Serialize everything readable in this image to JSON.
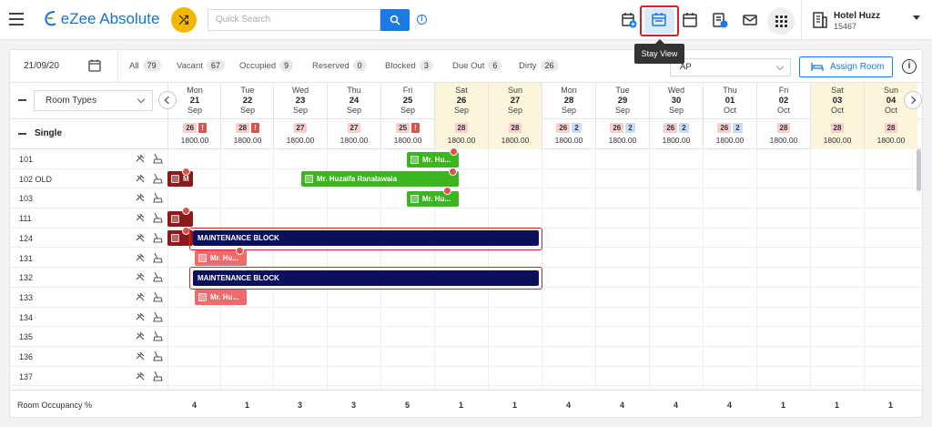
{
  "app": {
    "name": "eZee Absolute"
  },
  "search": {
    "placeholder": "Quick Search"
  },
  "tooltip": "Stay View",
  "hotel": {
    "name": "Hotel Huzz",
    "id": "15467"
  },
  "filters": {
    "date": "21/09/20",
    "items": [
      {
        "label": "All",
        "count": "79"
      },
      {
        "label": "Vacant",
        "count": "67"
      },
      {
        "label": "Occupied",
        "count": "9"
      },
      {
        "label": "Reserved",
        "count": "0"
      },
      {
        "label": "Blocked",
        "count": "3"
      },
      {
        "label": "Due Out",
        "count": "6"
      },
      {
        "label": "Dirty",
        "count": "26"
      }
    ],
    "rate_select": "AP",
    "assign_label": "Assign Room"
  },
  "grid": {
    "room_types_label": "Room Types",
    "category": "Single",
    "days": [
      {
        "dow": "Mon",
        "day": "21",
        "mon": "Sep",
        "weekend": false
      },
      {
        "dow": "Tue",
        "day": "22",
        "mon": "Sep",
        "weekend": false
      },
      {
        "dow": "Wed",
        "day": "23",
        "mon": "Sep",
        "weekend": false
      },
      {
        "dow": "Thu",
        "day": "24",
        "mon": "Sep",
        "weekend": false
      },
      {
        "dow": "Fri",
        "day": "25",
        "mon": "Sep",
        "weekend": false
      },
      {
        "dow": "Sat",
        "day": "26",
        "mon": "Sep",
        "weekend": true
      },
      {
        "dow": "Sun",
        "day": "27",
        "mon": "Sep",
        "weekend": true
      },
      {
        "dow": "Mon",
        "day": "28",
        "mon": "Sep",
        "weekend": false
      },
      {
        "dow": "Tue",
        "day": "29",
        "mon": "Sep",
        "weekend": false
      },
      {
        "dow": "Wed",
        "day": "30",
        "mon": "Sep",
        "weekend": false
      },
      {
        "dow": "Thu",
        "day": "01",
        "mon": "Oct",
        "weekend": false
      },
      {
        "dow": "Fri",
        "day": "02",
        "mon": "Oct",
        "weekend": false
      },
      {
        "dow": "Sat",
        "day": "03",
        "mon": "Oct",
        "weekend": true
      },
      {
        "dow": "Sun",
        "day": "04",
        "mon": "Oct",
        "weekend": true
      }
    ],
    "availability": [
      {
        "avail": "26",
        "flag": "!",
        "blue": "",
        "rate": "1800.00"
      },
      {
        "avail": "28",
        "flag": "!",
        "blue": "",
        "rate": "1800.00"
      },
      {
        "avail": "27",
        "flag": "",
        "blue": "",
        "rate": "1800.00"
      },
      {
        "avail": "27",
        "flag": "",
        "blue": "",
        "rate": "1800.00"
      },
      {
        "avail": "25",
        "flag": "!",
        "blue": "",
        "rate": "1800.00"
      },
      {
        "avail": "28",
        "flag": "",
        "blue": "",
        "rate": "1800.00"
      },
      {
        "avail": "28",
        "flag": "",
        "blue": "",
        "rate": "1800.00"
      },
      {
        "avail": "26",
        "flag": "",
        "blue": "2",
        "rate": "1800.00"
      },
      {
        "avail": "26",
        "flag": "",
        "blue": "2",
        "rate": "1800.00"
      },
      {
        "avail": "26",
        "flag": "",
        "blue": "2",
        "rate": "1800.00"
      },
      {
        "avail": "26",
        "flag": "",
        "blue": "2",
        "rate": "1800.00"
      },
      {
        "avail": "28",
        "flag": "",
        "blue": "",
        "rate": "1800.00"
      },
      {
        "avail": "28",
        "flag": "",
        "blue": "",
        "rate": "1800.00"
      },
      {
        "avail": "28",
        "flag": "",
        "blue": "",
        "rate": "1800.00"
      }
    ],
    "rooms": [
      "101",
      "102 OLD",
      "103",
      "111",
      "124",
      "131",
      "132",
      "133",
      "134",
      "135",
      "136",
      "137"
    ],
    "bookings": [
      {
        "text": "Mr. Hu...",
        "kind": "green"
      },
      {
        "text": "M",
        "kind": "maroon"
      },
      {
        "text": "Mr. Huzaifa Ranalawala",
        "kind": "green"
      },
      {
        "text": "Mr. Hu...",
        "kind": "green"
      },
      {
        "text": "",
        "kind": "maroon"
      },
      {
        "text": "",
        "kind": "maroon"
      },
      {
        "text": "MAINTENANCE BLOCK",
        "kind": "navy"
      },
      {
        "text": "Mr. Hu...",
        "kind": "pink"
      },
      {
        "text": "MAINTENANCE BLOCK",
        "kind": "navy"
      },
      {
        "text": "Mr. Hu...",
        "kind": "pink"
      }
    ],
    "footer_label": "Room Occupancy %",
    "occupancy": [
      "4",
      "1",
      "3",
      "3",
      "5",
      "1",
      "1",
      "4",
      "4",
      "4",
      "4",
      "1",
      "1",
      "1"
    ]
  },
  "colors": {
    "accent": "#1a7be6",
    "highlight": "#e02020",
    "weekend": "#fdf4dc"
  }
}
